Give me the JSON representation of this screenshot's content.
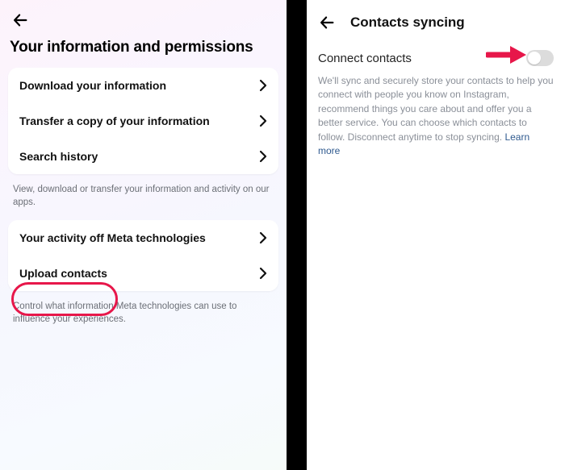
{
  "left": {
    "title": "Your information and permissions",
    "group1": {
      "items": [
        {
          "label": "Download your information"
        },
        {
          "label": "Transfer a copy of your information"
        },
        {
          "label": "Search history"
        }
      ],
      "caption": "View, download or transfer your information and activity on our apps."
    },
    "group2": {
      "items": [
        {
          "label": "Your activity off Meta technologies"
        },
        {
          "label": "Upload contacts"
        }
      ],
      "caption": "Control what information Meta technologies can use to influence your experiences."
    }
  },
  "right": {
    "title": "Contacts syncing",
    "connect_label": "Connect contacts",
    "description": "We'll sync and securely store your contacts to help you connect with people you know on Instagram, recommend things you care about and offer you a better service. You can choose which contacts to follow. Disconnect anytime to stop syncing. ",
    "learn_more": "Learn more"
  }
}
